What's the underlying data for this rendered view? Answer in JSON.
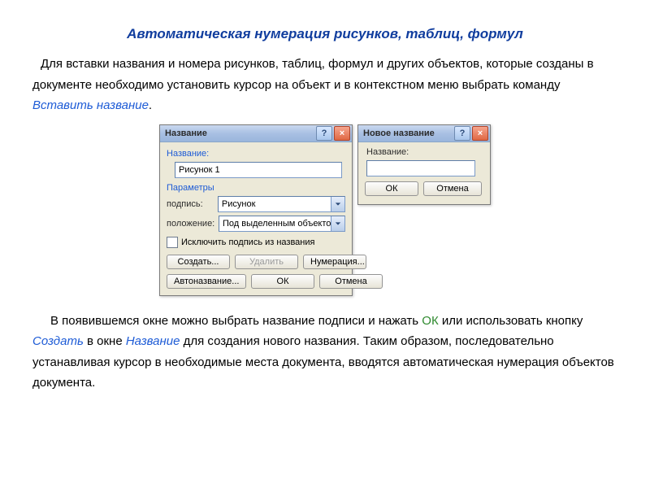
{
  "heading": "Автоматическая нумерация рисунков, таблиц, формул",
  "para1_lead": "Для вставки названия и номера рисунков, таблиц, формул и других объектов, которые созданы в документе необходимо установить курсор на объект и в контекстном меню выбрать команду ",
  "insert_caption": "Вставить название",
  "period": ".",
  "dialog1": {
    "title": "Название",
    "help": "?",
    "close": "×",
    "section_name": "Название:",
    "name_value": "Рисунок 1",
    "section_params": "Параметры",
    "row_caption_lbl": "подпись:",
    "row_caption_val": "Рисунок",
    "row_pos_lbl": "положение:",
    "row_pos_val": "Под выделенным объектом",
    "chk_label": "Исключить подпись из названия",
    "btn_create": "Создать...",
    "btn_delete": "Удалить",
    "btn_numbering": "Нумерация...",
    "btn_autoname": "Автоназвание...",
    "btn_ok": "ОК",
    "btn_cancel": "Отмена"
  },
  "dialog2": {
    "title": "Новое название",
    "help": "?",
    "close": "×",
    "section_name": "Название:",
    "btn_ok": "ОК",
    "btn_cancel": "Отмена"
  },
  "para2_a": "В появившемся окне можно выбрать название подписи и нажать ",
  "para2_ok": "ОК",
  "para2_b": " или использовать кнопку ",
  "para2_create": "Создать",
  "para2_c": " в окне ",
  "para2_name": "Название",
  "para2_d": " для создания нового названия. Таким образом, последовательно устанавливая курсор в необходимые места документа, вводятся  автоматическая нумерация объектов документа."
}
